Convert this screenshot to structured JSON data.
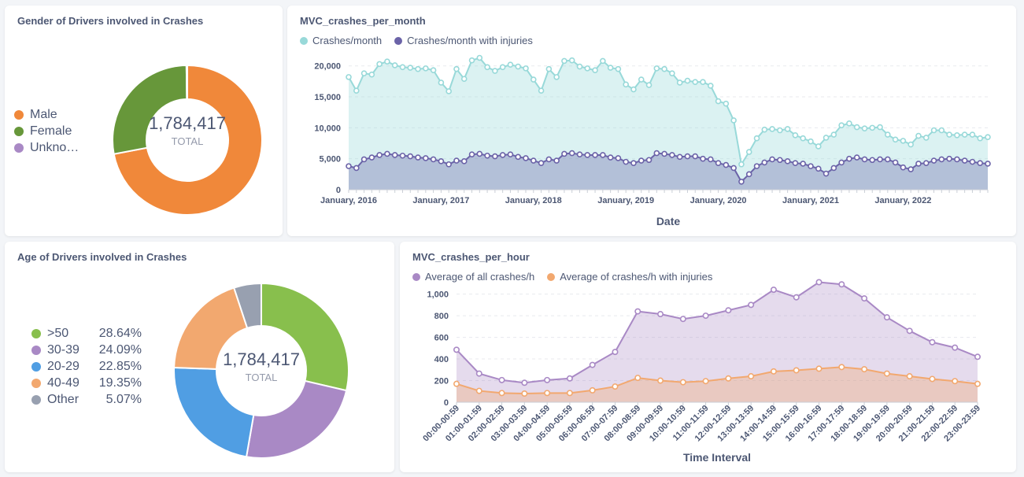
{
  "gender_card": {
    "title": "Gender of Drivers involved in Crashes",
    "total": "1,784,417",
    "total_label": "TOTAL",
    "legend": [
      {
        "label": "Male",
        "color": "#f0883a"
      },
      {
        "label": "Female",
        "color": "#67973a"
      },
      {
        "label": "Unkno…",
        "color": "#a989c5"
      }
    ]
  },
  "month_card": {
    "title": "MVC_crashes_per_month",
    "legend": [
      {
        "label": "Crashes/month",
        "color": "#98d9d9"
      },
      {
        "label": "Crashes/month with injuries",
        "color": "#6b63a8"
      }
    ]
  },
  "age_card": {
    "title": "Age of Drivers involved in Crashes",
    "total": "1,784,417",
    "total_label": "TOTAL",
    "legend": [
      {
        "label": ">50",
        "pct": "28.64%",
        "color": "#88bf4d"
      },
      {
        "label": "30-39",
        "pct": "24.09%",
        "color": "#a989c5"
      },
      {
        "label": "20-29",
        "pct": "22.85%",
        "color": "#509ee3"
      },
      {
        "label": "40-49",
        "pct": "19.35%",
        "color": "#f2a86f"
      },
      {
        "label": "Other",
        "pct": "5.07%",
        "color": "#98a0b0"
      }
    ]
  },
  "hour_card": {
    "title": "MVC_crashes_per_hour",
    "legend": [
      {
        "label": "Average of all crashes/h",
        "color": "#a989c5"
      },
      {
        "label": "Average of crashes/h with injuries",
        "color": "#f2a86f"
      }
    ]
  },
  "chart_data": [
    {
      "type": "pie",
      "title": "Gender of Drivers involved in Crashes",
      "categories": [
        "Male",
        "Female",
        "Unkno…"
      ],
      "values": [
        1285000,
        496000,
        3417
      ],
      "colors": [
        "#f0883a",
        "#67973a",
        "#a989c5"
      ]
    },
    {
      "type": "area",
      "title": "MVC_crashes_per_month",
      "xlabel": "Date",
      "ylabel": "",
      "ylim": [
        0,
        22000
      ],
      "yticks": [
        0,
        5000,
        10000,
        15000,
        20000
      ],
      "ytick_labels": [
        "0",
        "5,000",
        "10,000",
        "15,000",
        "20,000"
      ],
      "xtick_labels": [
        "January, 2016",
        "January, 2017",
        "January, 2018",
        "January, 2019",
        "January, 2020",
        "January, 2021",
        "January, 2022"
      ],
      "x_start": "2016-01",
      "series": [
        {
          "name": "Crashes/month",
          "color": "#98d9d9",
          "values": [
            18200,
            16000,
            18800,
            18600,
            20300,
            20700,
            20100,
            19800,
            19700,
            19500,
            19600,
            19300,
            17300,
            15900,
            19500,
            17900,
            20900,
            21300,
            19800,
            19200,
            19800,
            20200,
            19900,
            19600,
            17800,
            16000,
            19500,
            18200,
            20800,
            20900,
            19900,
            19600,
            19300,
            20800,
            19700,
            19500,
            17000,
            16200,
            17800,
            16900,
            19600,
            19500,
            18800,
            17300,
            17600,
            17400,
            17400,
            16800,
            14300,
            13900,
            11200,
            4100,
            6100,
            8300,
            9700,
            9800,
            9600,
            9800,
            8800,
            8300,
            7800,
            7000,
            8400,
            8900,
            10400,
            10700,
            10100,
            9900,
            10000,
            10100,
            8900,
            8100,
            7900,
            7300,
            8700,
            8400,
            9600,
            9600,
            8900,
            8800,
            8900,
            8900,
            8300,
            8500
          ]
        },
        {
          "name": "Crashes/month with injuries",
          "color": "#6b63a8",
          "values": [
            3800,
            3500,
            4900,
            5200,
            5600,
            5800,
            5600,
            5500,
            5400,
            5200,
            5100,
            4900,
            4600,
            4100,
            4700,
            4600,
            5700,
            5800,
            5500,
            5400,
            5600,
            5700,
            5300,
            5100,
            4700,
            4300,
            4900,
            4700,
            5800,
            5900,
            5700,
            5600,
            5600,
            5600,
            5200,
            5100,
            4500,
            4300,
            4700,
            4800,
            5900,
            5800,
            5600,
            5300,
            5400,
            5400,
            5000,
            4900,
            4300,
            4000,
            3500,
            1300,
            2500,
            3800,
            4400,
            4900,
            4800,
            4600,
            4300,
            4200,
            3800,
            3400,
            2600,
            3500,
            4400,
            5000,
            5200,
            4900,
            4800,
            4900,
            4900,
            4400,
            3600,
            3300,
            4200,
            4300,
            4700,
            4900,
            5000,
            4900,
            4700,
            4500,
            4300,
            4200
          ]
        }
      ]
    },
    {
      "type": "pie",
      "title": "Age of Drivers involved in Crashes",
      "categories": [
        ">50",
        "30-39",
        "20-29",
        "40-49",
        "Other"
      ],
      "values": [
        28.64,
        24.09,
        22.85,
        19.35,
        5.07
      ],
      "colors": [
        "#88bf4d",
        "#a989c5",
        "#509ee3",
        "#f2a86f",
        "#98a0b0"
      ]
    },
    {
      "type": "area",
      "title": "MVC_crashes_per_hour",
      "xlabel": "Time Interval",
      "ylabel": "",
      "ylim": [
        0,
        1150
      ],
      "yticks": [
        0,
        200,
        400,
        600,
        800,
        1000
      ],
      "ytick_labels": [
        "0",
        "200",
        "400",
        "600",
        "800",
        "1,000"
      ],
      "categories": [
        "00:00-00:59",
        "01:00-01:59",
        "02:00-02:59",
        "03:00-03:59",
        "04:00-04:59",
        "05:00-05:59",
        "06:00-06:59",
        "07:00-07:59",
        "08:00-08:59",
        "09:00-09:59",
        "10:00-10:59",
        "11:00-11:59",
        "12:00-12:59",
        "13:00-13:59",
        "14:00-14:59",
        "15:00-15:59",
        "16:00-16:59",
        "17:00-17:59",
        "18:00-18:59",
        "19:00-19:59",
        "20:00-20:59",
        "21:00-21:59",
        "22:00-22:59",
        "23:00-23:59"
      ],
      "series": [
        {
          "name": "Average of all crashes/h",
          "color": "#a989c5",
          "values": [
            485,
            265,
            205,
            180,
            205,
            220,
            345,
            465,
            840,
            815,
            770,
            800,
            850,
            900,
            1040,
            970,
            1110,
            1090,
            960,
            785,
            660,
            555,
            505,
            420
          ]
        },
        {
          "name": "Average of crashes/h with injuries",
          "color": "#f2a86f",
          "values": [
            170,
            105,
            85,
            80,
            85,
            85,
            110,
            145,
            225,
            200,
            185,
            195,
            220,
            240,
            285,
            295,
            310,
            325,
            305,
            265,
            240,
            215,
            195,
            170
          ]
        }
      ]
    }
  ]
}
